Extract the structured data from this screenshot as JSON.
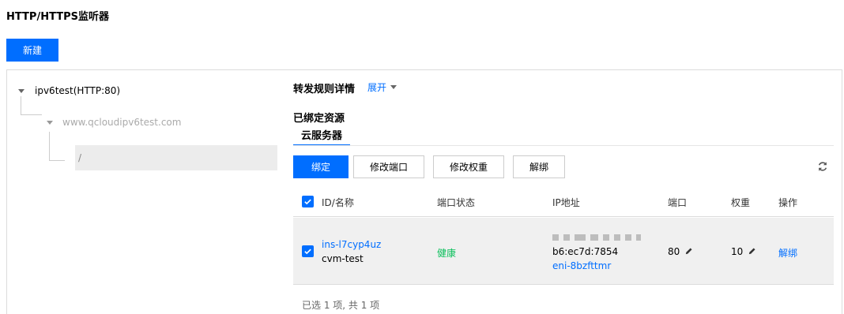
{
  "page": {
    "title": "HTTP/HTTPS监听器",
    "new_button": "新建"
  },
  "tree": {
    "listener": "ipv6test(HTTP:80)",
    "domain": "www.qcloudipv6test.com",
    "path": "/"
  },
  "detail": {
    "title": "转发规则详情",
    "expand": "展开",
    "bound_title": "已绑定资源",
    "tab": "云服务器",
    "buttons": {
      "bind": "绑定",
      "modify_port": "修改端口",
      "modify_weight": "修改权重",
      "unbind": "解绑"
    }
  },
  "table": {
    "columns": [
      "ID/名称",
      "端口状态",
      "IP地址",
      "端口",
      "权重",
      "操作"
    ],
    "rows": [
      {
        "id": "ins-l7cyp4uz",
        "name": "cvm-test",
        "status": "健康",
        "ip_line2": "b6:ec7d:7854",
        "eni": "eni-8bzfttmr",
        "port": "80",
        "weight": "10",
        "action": "解绑"
      }
    ],
    "footer": "已选 1 项, 共 1 项"
  },
  "colors": {
    "accent": "#006eff",
    "healthy": "#0abf5b"
  },
  "icons": [
    "caret-down-icon",
    "refresh-icon",
    "checkbox-icon",
    "edit-pencil-icon"
  ]
}
